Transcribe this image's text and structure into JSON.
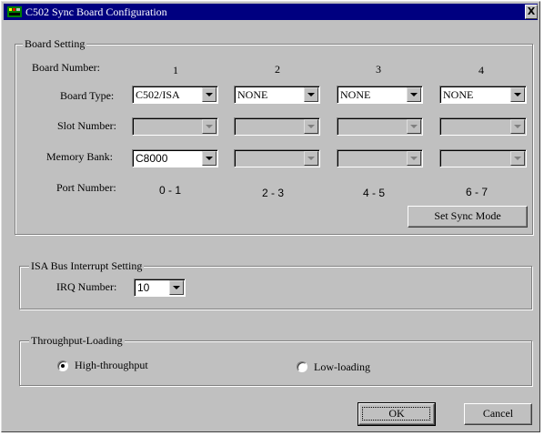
{
  "window": {
    "title": "C502 Sync Board Configuration",
    "close_glyph": "X"
  },
  "board_setting": {
    "title": "Board Setting",
    "labels": {
      "board_number": "Board Number:",
      "board_type": "Board Type:",
      "slot_number": "Slot Number:",
      "memory_bank": "Memory Bank:",
      "port_number": "Port Number:"
    },
    "boards": [
      {
        "number": "1",
        "type": "C502/ISA",
        "slot": "",
        "memory": "C8000",
        "ports": "0 - 1"
      },
      {
        "number": "2",
        "type": "NONE",
        "slot": "",
        "memory": "",
        "ports": "2 - 3"
      },
      {
        "number": "3",
        "type": "NONE",
        "slot": "",
        "memory": "",
        "ports": "4 - 5"
      },
      {
        "number": "4",
        "type": "NONE",
        "slot": "",
        "memory": "",
        "ports": "6 - 7"
      }
    ],
    "set_sync_mode_label": "Set Sync Mode"
  },
  "isa_interrupt": {
    "title": "ISA Bus Interrupt Setting",
    "irq_label": "IRQ Number:",
    "irq_value": "10"
  },
  "throughput": {
    "title": "Throughput-Loading",
    "options": [
      {
        "label": "High-throughput",
        "selected": true
      },
      {
        "label": "Low-loading",
        "selected": false
      }
    ]
  },
  "buttons": {
    "ok": "OK",
    "cancel": "Cancel"
  },
  "colors": {
    "titlebar": "#000080",
    "face": "#c0c0c0"
  }
}
